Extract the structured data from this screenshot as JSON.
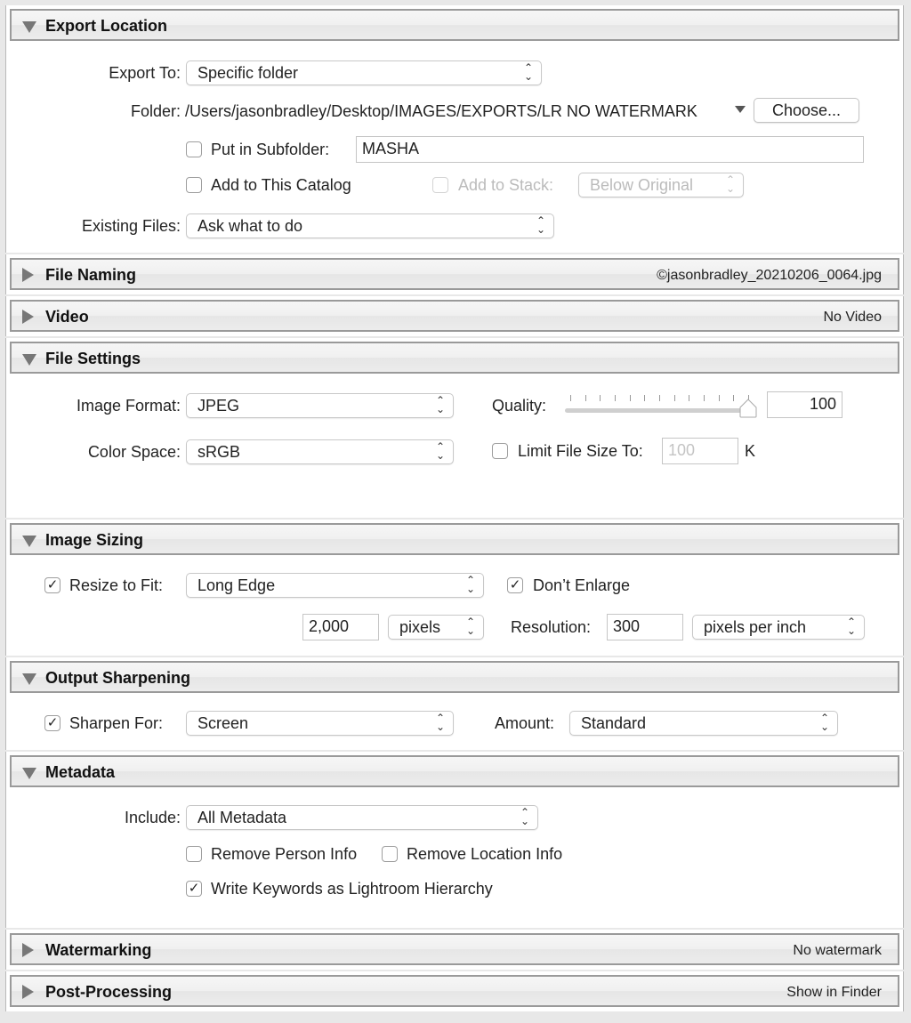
{
  "sections": {
    "export_location": {
      "title": "Export Location",
      "expanded": true,
      "export_to_label": "Export To:",
      "export_to_value": "Specific folder",
      "folder_label": "Folder:",
      "folder_path": "/Users/jasonbradley/Desktop/IMAGES/EXPORTS/LR NO WATERMARK",
      "choose_button": "Choose...",
      "put_in_subfolder_label": "Put in Subfolder:",
      "put_in_subfolder_checked": false,
      "subfolder_value": "MASHA",
      "add_to_catalog_label": "Add to This Catalog",
      "add_to_catalog_checked": false,
      "add_to_stack_label": "Add to Stack:",
      "add_to_stack_checked": false,
      "stack_position_value": "Below Original",
      "existing_files_label": "Existing Files:",
      "existing_files_value": "Ask what to do"
    },
    "file_naming": {
      "title": "File Naming",
      "expanded": false,
      "summary": "©jasonbradley_20210206_0064.jpg"
    },
    "video": {
      "title": "Video",
      "expanded": false,
      "summary": "No Video"
    },
    "file_settings": {
      "title": "File Settings",
      "expanded": true,
      "image_format_label": "Image Format:",
      "image_format_value": "JPEG",
      "quality_label": "Quality:",
      "quality_value": "100",
      "quality_fraction": 1.0,
      "color_space_label": "Color Space:",
      "color_space_value": "sRGB",
      "limit_file_size_label": "Limit File Size To:",
      "limit_file_size_checked": false,
      "limit_file_size_value": "100",
      "limit_file_size_unit": "K"
    },
    "image_sizing": {
      "title": "Image Sizing",
      "expanded": true,
      "resize_to_fit_label": "Resize to Fit:",
      "resize_to_fit_checked": true,
      "resize_mode_value": "Long Edge",
      "dont_enlarge_label": "Don’t Enlarge",
      "dont_enlarge_checked": true,
      "size_value": "2,000",
      "size_unit_value": "pixels",
      "resolution_label": "Resolution:",
      "resolution_value": "300",
      "resolution_unit_value": "pixels per inch"
    },
    "output_sharpening": {
      "title": "Output Sharpening",
      "expanded": true,
      "sharpen_for_label": "Sharpen For:",
      "sharpen_for_checked": true,
      "sharpen_for_value": "Screen",
      "amount_label": "Amount:",
      "amount_value": "Standard"
    },
    "metadata": {
      "title": "Metadata",
      "expanded": true,
      "include_label": "Include:",
      "include_value": "All Metadata",
      "remove_person_label": "Remove Person Info",
      "remove_person_checked": false,
      "remove_location_label": "Remove Location Info",
      "remove_location_checked": false,
      "write_keywords_label": "Write Keywords as Lightroom Hierarchy",
      "write_keywords_checked": true
    },
    "watermarking": {
      "title": "Watermarking",
      "expanded": false,
      "summary": "No watermark"
    },
    "post_processing": {
      "title": "Post-Processing",
      "expanded": false,
      "summary": "Show in Finder"
    }
  },
  "glyphs": {
    "check": "✓",
    "updown": "⌃⌄"
  }
}
